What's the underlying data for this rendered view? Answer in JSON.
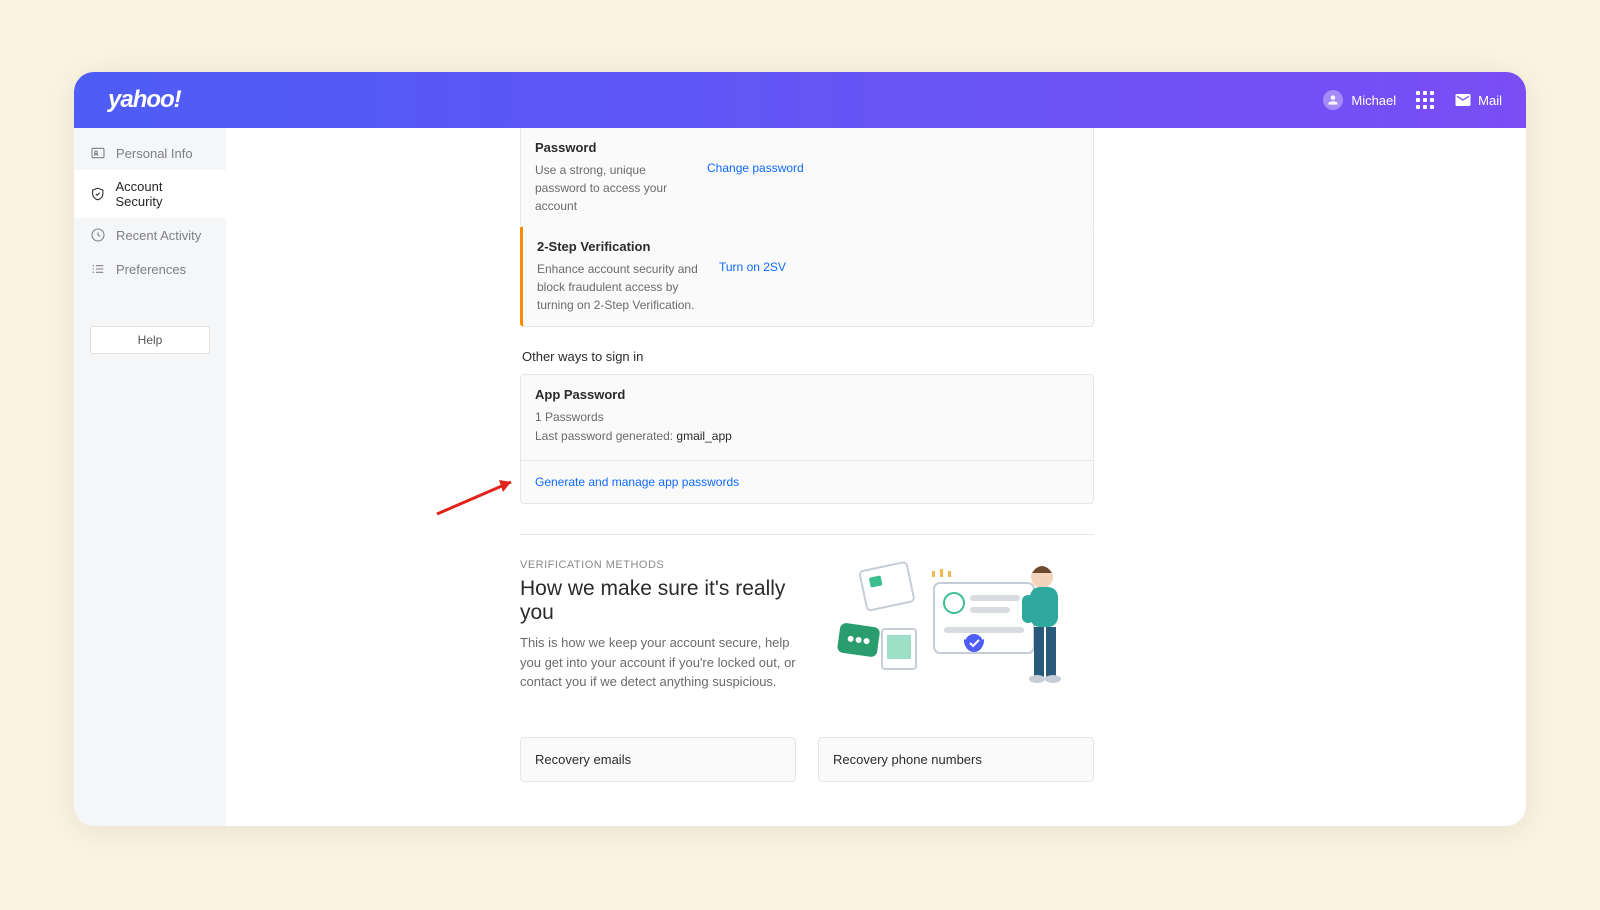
{
  "header": {
    "logo": "yahoo!",
    "user_name": "Michael",
    "mail_label": "Mail"
  },
  "sidebar": {
    "items": [
      {
        "label": "Personal Info"
      },
      {
        "label": "Account Security"
      },
      {
        "label": "Recent Activity"
      },
      {
        "label": "Preferences"
      }
    ],
    "help_label": "Help"
  },
  "password_card": {
    "title": "Password",
    "desc": "Use a strong, unique password to access your account",
    "link": "Change password"
  },
  "twosv_card": {
    "title": "2-Step Verification",
    "desc": "Enhance account security and block fraudulent access by turning on 2-Step Verification.",
    "link": "Turn on 2SV"
  },
  "other_ways_title": "Other ways to sign in",
  "app_password_card": {
    "title": "App Password",
    "count_line": "1 Passwords",
    "last_line_prefix": "Last password generated: ",
    "last_app": "gmail_app",
    "manage_link": "Generate and manage app passwords"
  },
  "verification": {
    "label": "VERIFICATION METHODS",
    "title": "How we make sure it's really you",
    "desc": "This is how we keep your account secure, help you get into your account if you're locked out, or contact you if we detect anything suspicious."
  },
  "recovery_cards": {
    "emails": "Recovery emails",
    "phones": "Recovery phone numbers"
  }
}
